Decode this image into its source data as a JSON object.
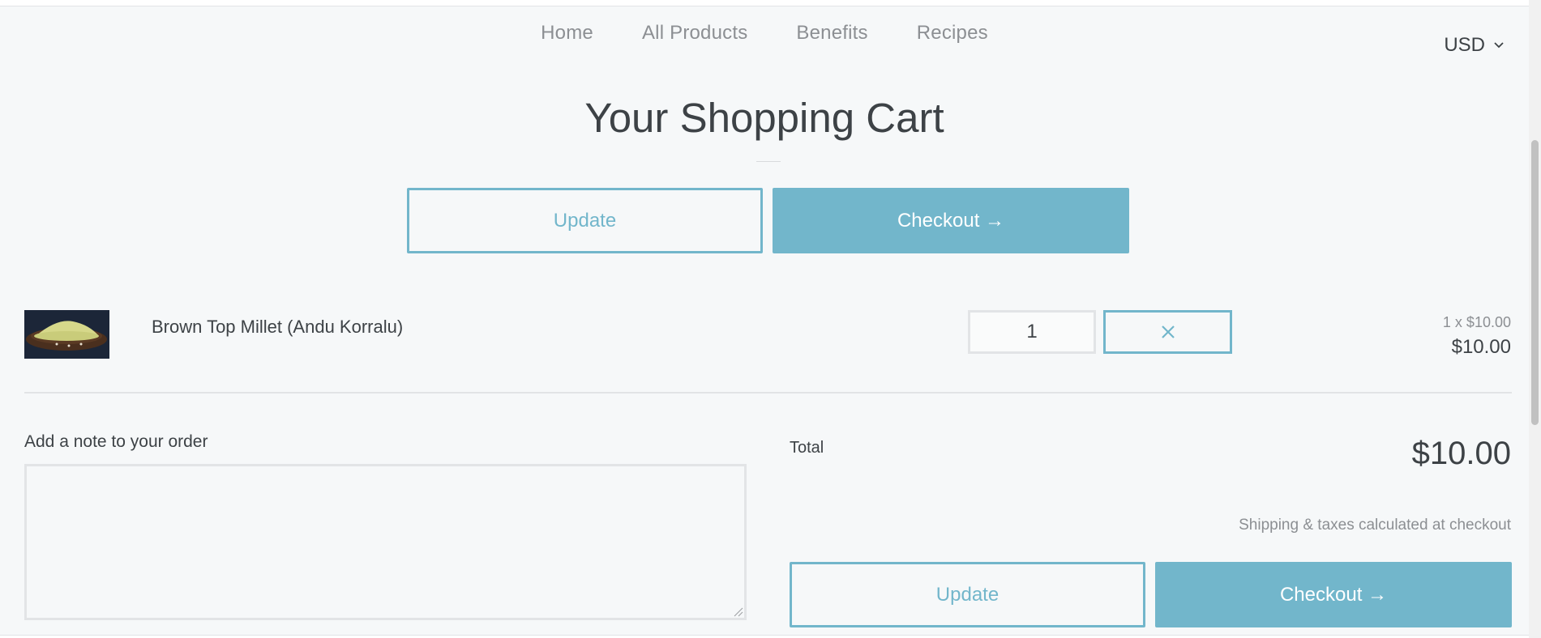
{
  "nav": {
    "items": [
      "Home",
      "All Products",
      "Benefits",
      "Recipes"
    ]
  },
  "currency": {
    "selected": "USD"
  },
  "page": {
    "title": "Your Shopping Cart"
  },
  "actions": {
    "update_label": "Update",
    "checkout_label": "Checkout →"
  },
  "cart": {
    "items": [
      {
        "name": "Brown Top Millet (Andu Korralu)",
        "quantity": "1",
        "unit_price": "1 x $10.00",
        "line_price": "$10.00"
      }
    ]
  },
  "note": {
    "label": "Add a note to your order",
    "value": ""
  },
  "summary": {
    "total_label": "Total",
    "total_value": "$10.00",
    "shipping_text": "Shipping & taxes calculated at checkout"
  },
  "colors": {
    "accent": "#72b6cb",
    "background": "#f6f8f9",
    "text": "#3d4246",
    "muted": "#8c8f93"
  }
}
